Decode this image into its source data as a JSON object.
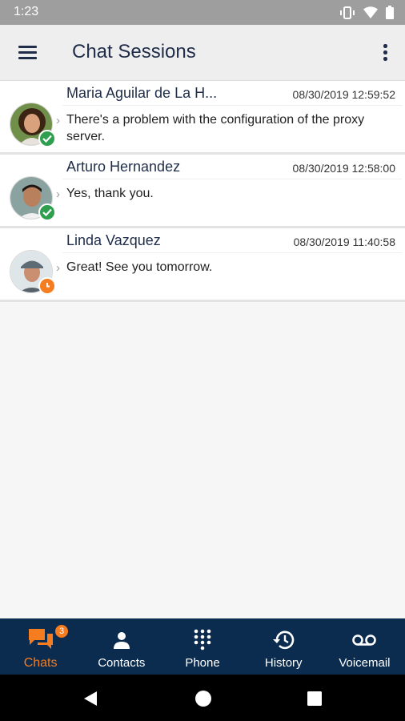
{
  "status_bar": {
    "time": "1:23"
  },
  "header": {
    "title": "Chat Sessions"
  },
  "chats": [
    {
      "name": "Maria Aguilar de La H...",
      "timestamp": "08/30/2019 12:59:52",
      "message": "There's a problem with the configuration of the proxy server.",
      "presence": "available"
    },
    {
      "name": "Arturo Hernandez",
      "timestamp": "08/30/2019 12:58:00",
      "message": "Yes, thank you.",
      "presence": "available"
    },
    {
      "name": "Linda Vazquez",
      "timestamp": "08/30/2019 11:40:58",
      "message": "Great! See you tomorrow.",
      "presence": "away"
    }
  ],
  "bottom_nav": {
    "chats": {
      "label": "Chats",
      "badge": "3",
      "icon": "chat-bubbles-icon"
    },
    "contacts": {
      "label": "Contacts",
      "icon": "person-icon"
    },
    "phone": {
      "label": "Phone",
      "icon": "dialpad-icon"
    },
    "history": {
      "label": "History",
      "icon": "history-icon"
    },
    "voicemail": {
      "label": "Voicemail",
      "icon": "voicemail-icon"
    }
  },
  "colors": {
    "accent": "#f57c1f",
    "nav_background": "#0b2c4f",
    "available": "#2e9e4f",
    "away": "#f57c1f",
    "title": "#1f2d4a"
  }
}
